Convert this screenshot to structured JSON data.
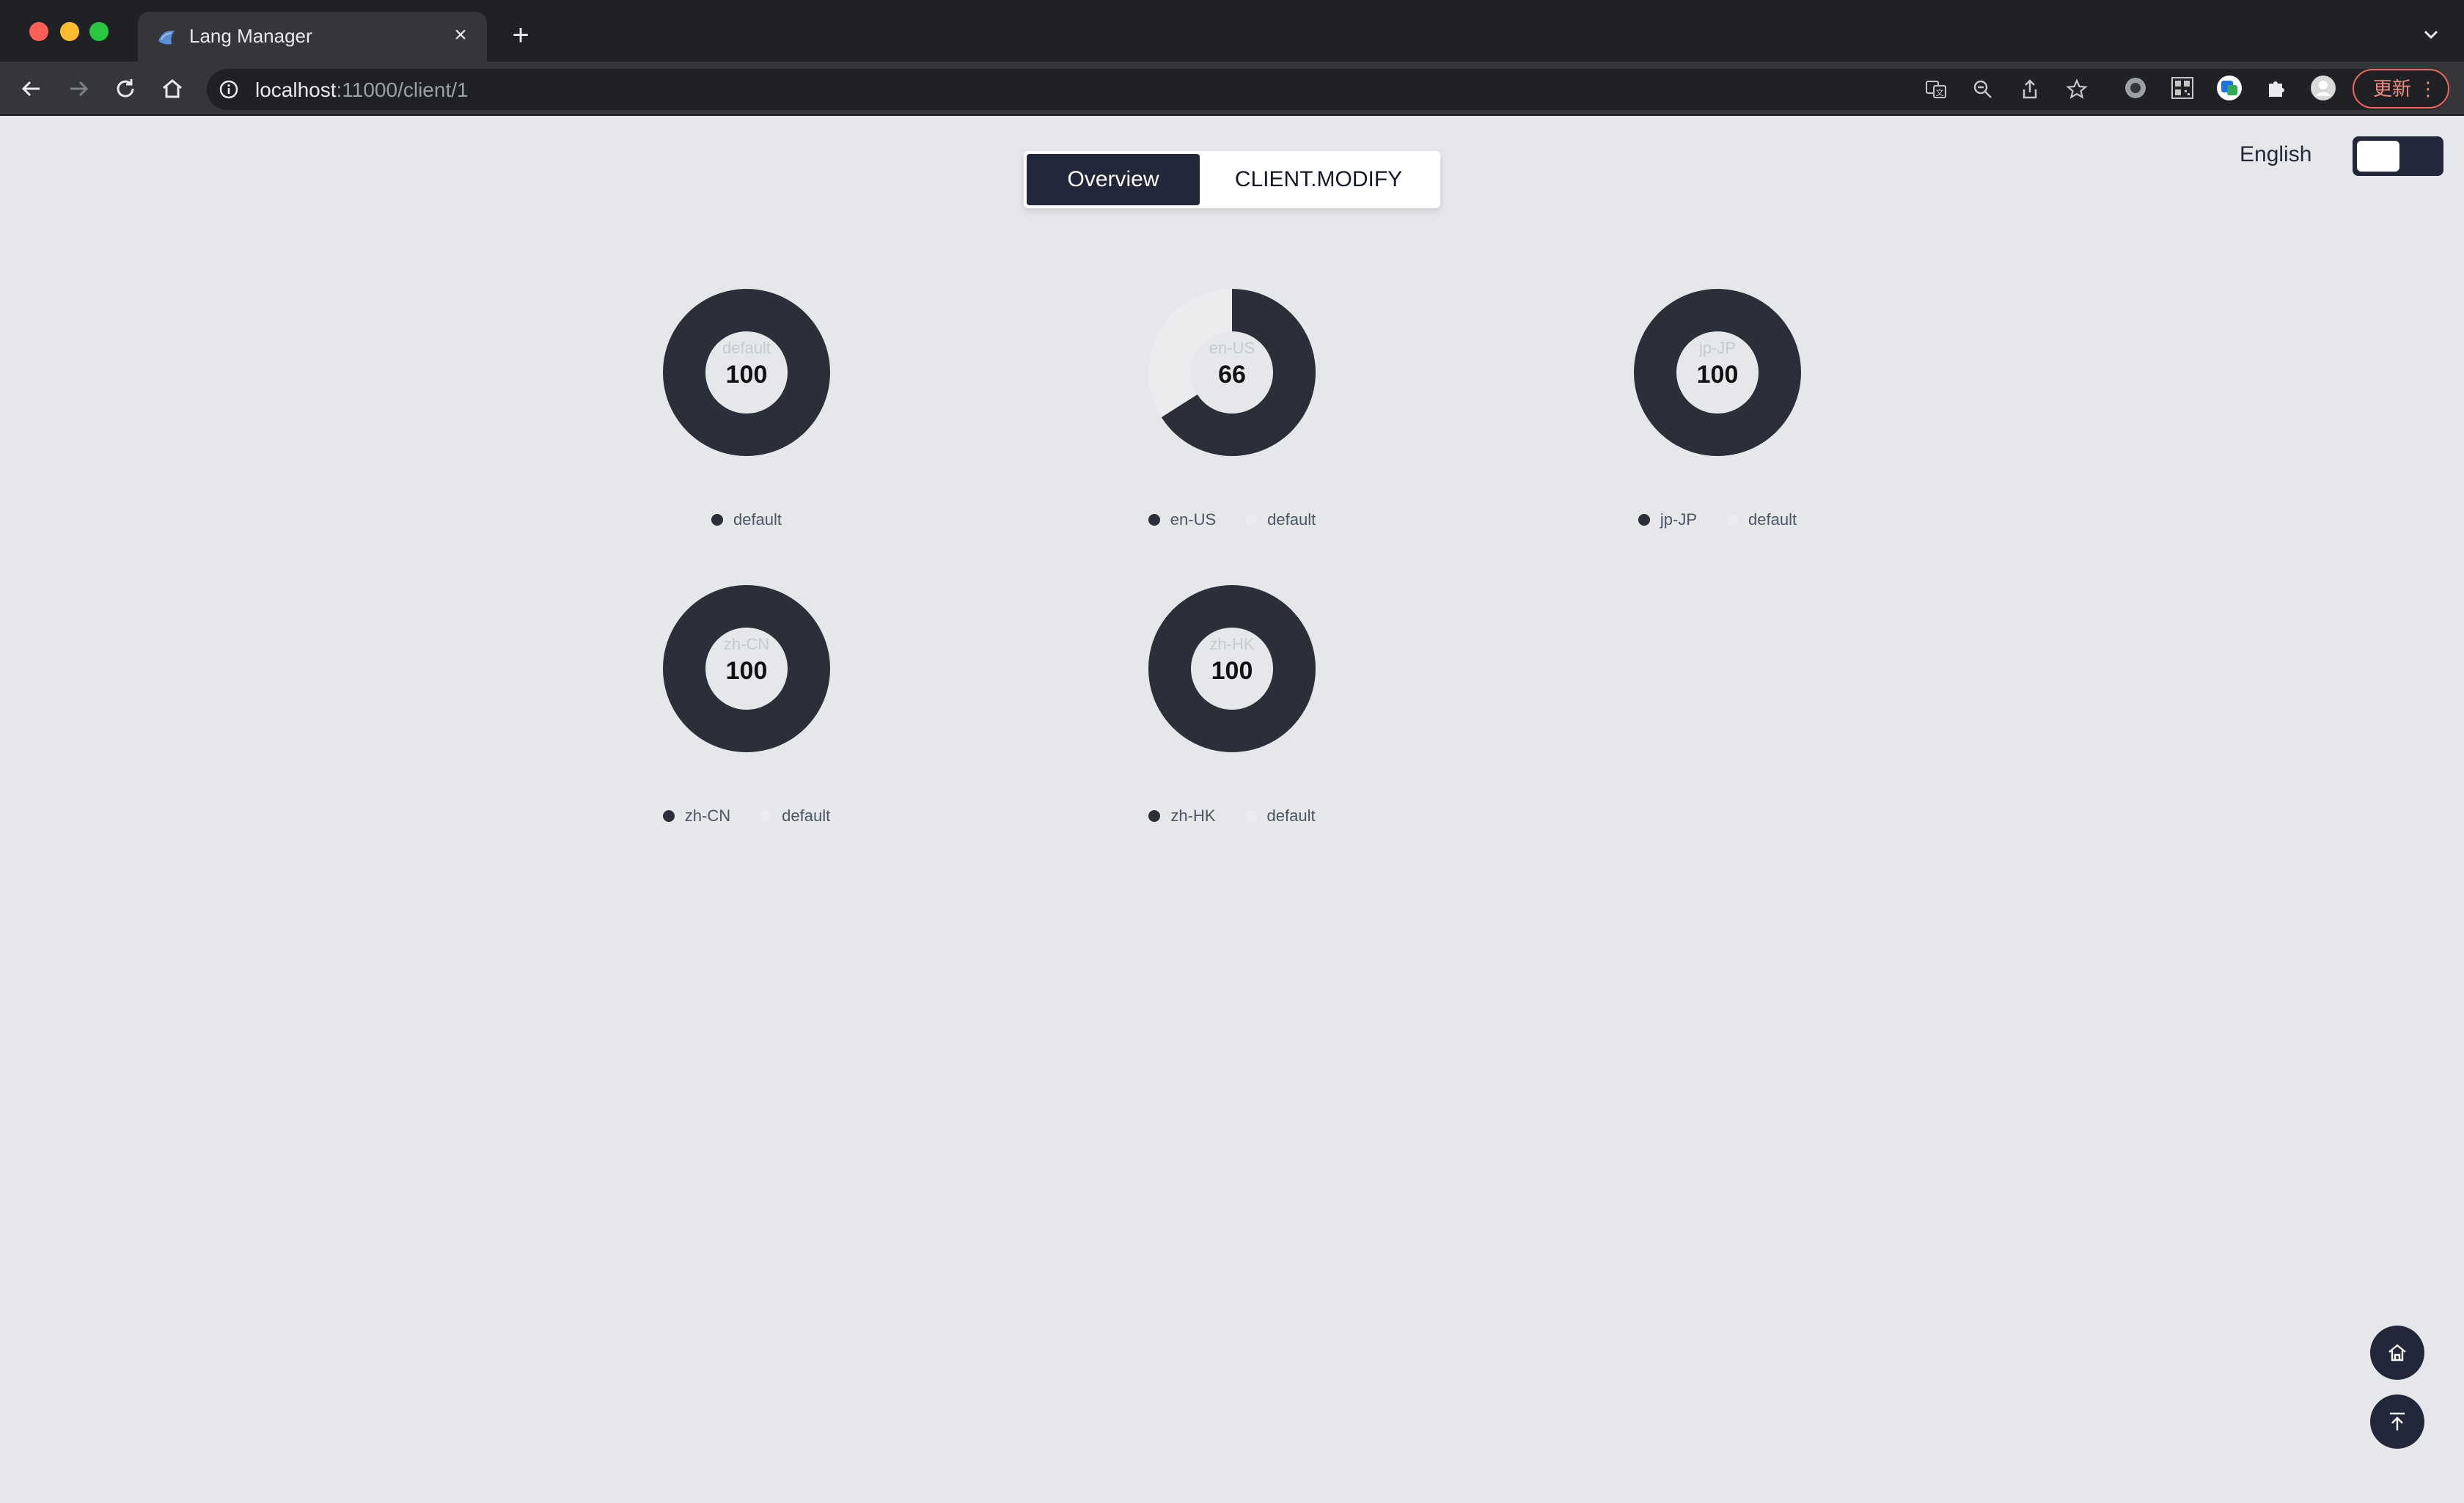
{
  "browser": {
    "tab_title": "Lang Manager",
    "url_host": "localhost",
    "url_rest": ":11000/client/1",
    "update_label": "更新"
  },
  "page": {
    "tabs": [
      {
        "label": "Overview",
        "active": true
      },
      {
        "label": "CLIENT.MODIFY",
        "active": false
      }
    ],
    "language_label": "English"
  },
  "colors": {
    "primary": "#2b2f3a",
    "secondary": "#ebecee",
    "background": "#e5e7eb"
  },
  "chart_data": [
    {
      "type": "pie",
      "title": "default",
      "center_value": "100",
      "legend": [
        "default"
      ],
      "values": [
        100
      ]
    },
    {
      "type": "pie",
      "title": "en-US",
      "center_value": "66",
      "legend": [
        "en-US",
        "default"
      ],
      "values": [
        66,
        34
      ]
    },
    {
      "type": "pie",
      "title": "jp-JP",
      "center_value": "100",
      "legend": [
        "jp-JP",
        "default"
      ],
      "values": [
        100,
        0
      ]
    },
    {
      "type": "pie",
      "title": "zh-CN",
      "center_value": "100",
      "legend": [
        "zh-CN",
        "default"
      ],
      "values": [
        100,
        0
      ]
    },
    {
      "type": "pie",
      "title": "zh-HK",
      "center_value": "100",
      "legend": [
        "zh-HK",
        "default"
      ],
      "values": [
        100,
        0
      ]
    }
  ],
  "icons": {
    "home_fab": "home-icon",
    "top_fab": "back-to-top-icon"
  }
}
